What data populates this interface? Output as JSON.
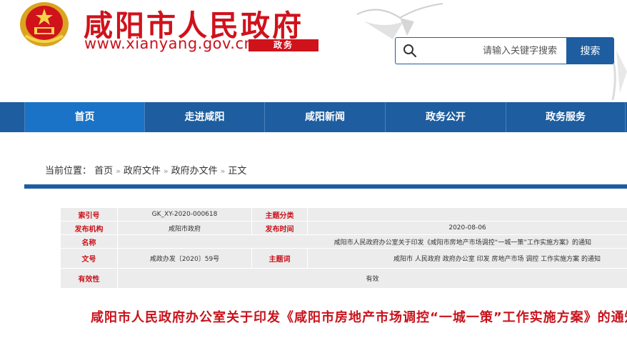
{
  "header": {
    "site_title": "咸阳市人民政府",
    "site_url": "www.xianyang.gov.cn",
    "tag": "政务",
    "emblem_icon": "national-emblem-icon",
    "search_placeholder": "请输入关键字搜索",
    "search_button": "搜索"
  },
  "nav": {
    "items": [
      {
        "label": "首页",
        "active": true
      },
      {
        "label": "走进咸阳",
        "active": false
      },
      {
        "label": "咸阳新闻",
        "active": false
      },
      {
        "label": "政务公开",
        "active": false
      },
      {
        "label": "政务服务",
        "active": false
      }
    ]
  },
  "breadcrumb": {
    "prefix": "当前位置：",
    "items": [
      "首页",
      "政府文件",
      "政府办文件",
      "正文"
    ]
  },
  "info": {
    "index_label": "索引号",
    "index_value": "GK_XY-2020-000618",
    "topic_label": "主题分类",
    "topic_value": "",
    "issuer_label": "发布机构",
    "issuer_value": "咸阳市政府",
    "date_label": "发布时间",
    "date_value": "2020-08-06",
    "name_label": "名称",
    "name_value": "咸阳市人民政府办公室关于印发《咸阳市房地产市场调控“一城一策”工作实施方案》的通知",
    "docno_label": "文号",
    "docno_value": "咸政办发〔2020〕59号",
    "keywords_label": "主题词",
    "keywords_value": "咸阳市 人民政府 政府办公室 印发 房地产市场 调控 工作实施方案 的通知",
    "validity_label": "有效性",
    "validity_value": "有效"
  },
  "doc_title": "咸阳市人民政府办公室关于印发《咸阳市房地产市场调控“一城一策”工作实施方案》的通知",
  "colors": {
    "brand_red": "#d0121b",
    "nav_blue": "#1e5d9f"
  }
}
